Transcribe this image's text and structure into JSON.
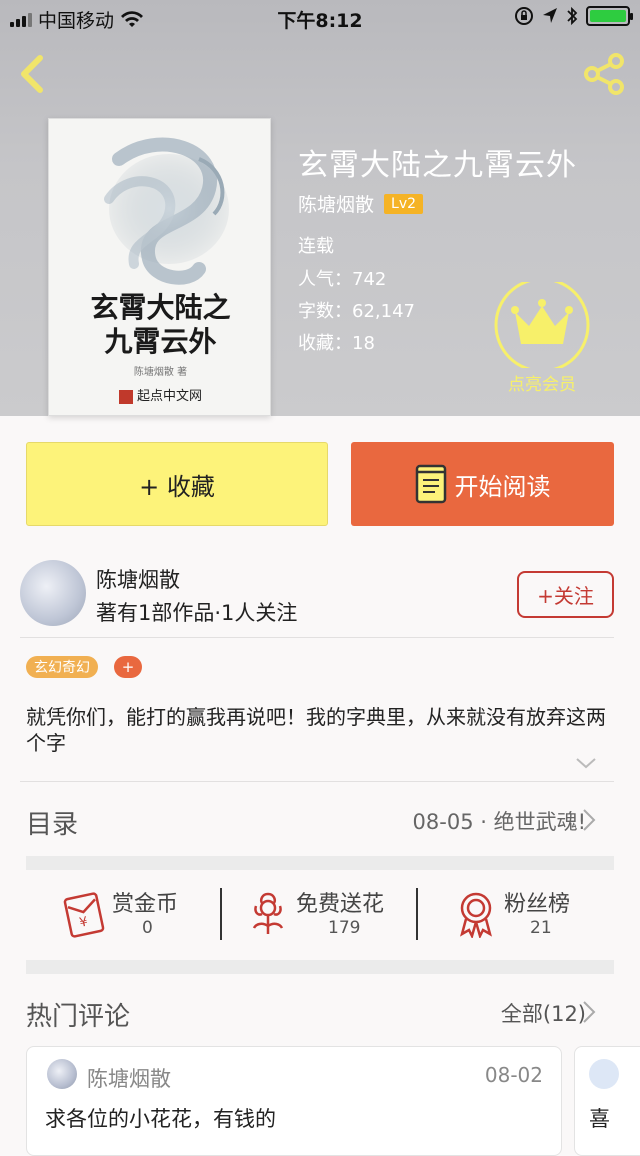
{
  "status_bar": {
    "carrier": "中国移动",
    "time": "下午8:12"
  },
  "book": {
    "title": "玄霄大陆之九霄云外",
    "author": "陈塘烟散",
    "level": "Lv2",
    "status": "连载",
    "popularity_label": "人气：",
    "popularity": "742",
    "word_count_label": "字数：",
    "word_count": "62,147",
    "favorites_label": "收藏：",
    "favorites": "18"
  },
  "cover": {
    "title_line1": "玄霄大陆之",
    "title_line2": "九霄云外",
    "author": "陈塘烟散 著",
    "publisher": "起点中文网"
  },
  "vip": {
    "label": "点亮会员",
    "color": "#f7f06a"
  },
  "actions": {
    "favorite_label": "+ 收藏",
    "read_label": "开始阅读"
  },
  "author_card": {
    "name": "陈塘烟散",
    "summary": "著有1部作品·1人关注",
    "follow_label": "+关注"
  },
  "tags": {
    "genre": "玄幻奇幻",
    "add": "+"
  },
  "intro": "就凭你们，能打的赢我再说吧！我的字典里，从来就没有放弃这两个字",
  "toc": {
    "label": "目录",
    "latest": "08-05 · 绝世武魂!"
  },
  "stats": [
    {
      "label": "赏金币",
      "value": "0",
      "icon": "red-envelope-icon"
    },
    {
      "label": "免费送花",
      "value": "179",
      "icon": "flower-icon"
    },
    {
      "label": "粉丝榜",
      "value": "21",
      "icon": "medal-icon"
    }
  ],
  "comments": {
    "section_label": "热门评论",
    "all_label": "全部(12)",
    "items": [
      {
        "user": "陈塘烟散",
        "date": "08-02",
        "text": "求各位的小花花，有钱的"
      },
      {
        "text": "喜"
      }
    ]
  },
  "colors": {
    "accent_red": "#c43a33",
    "read_button": "#e9683f",
    "favorite_button": "#fdf37a",
    "badge": "#f5b325"
  }
}
